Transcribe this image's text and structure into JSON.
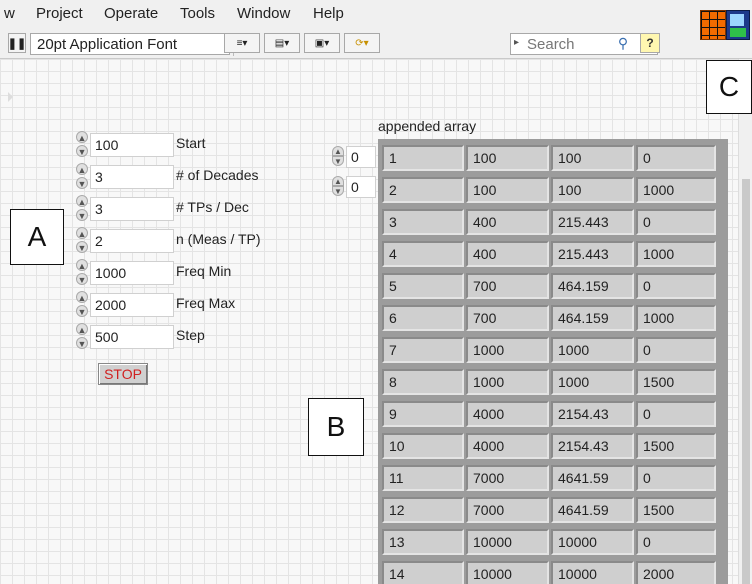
{
  "menu": {
    "items": [
      "w",
      "Project",
      "Operate",
      "Tools",
      "Window",
      "Help"
    ]
  },
  "toolbar": {
    "pause_icon": "pause-icon",
    "font": "20pt Application Font",
    "search_placeholder": "Search",
    "help_icon": "?"
  },
  "controls": [
    {
      "value": "100",
      "label": "Start"
    },
    {
      "value": "3",
      "label": "# of Decades"
    },
    {
      "value": "3",
      "label": "# TPs / Dec"
    },
    {
      "value": "2",
      "label": "n (Meas / TP)"
    },
    {
      "value": "1000",
      "label": "Freq Min"
    },
    {
      "value": "2000",
      "label": "Freq Max"
    },
    {
      "value": "500",
      "label": "Step"
    }
  ],
  "stop_label": "STOP",
  "array": {
    "label": "appended array",
    "index_row": "0",
    "index_col": "0",
    "rows": [
      [
        "1",
        "100",
        "100",
        "0"
      ],
      [
        "2",
        "100",
        "100",
        "1000"
      ],
      [
        "3",
        "400",
        "215.443",
        "0"
      ],
      [
        "4",
        "400",
        "215.443",
        "1000"
      ],
      [
        "5",
        "700",
        "464.159",
        "0"
      ],
      [
        "6",
        "700",
        "464.159",
        "1000"
      ],
      [
        "7",
        "1000",
        "1000",
        "0"
      ],
      [
        "8",
        "1000",
        "1000",
        "1500"
      ],
      [
        "9",
        "4000",
        "2154.43",
        "0"
      ],
      [
        "10",
        "4000",
        "2154.43",
        "1500"
      ],
      [
        "11",
        "7000",
        "4641.59",
        "0"
      ],
      [
        "12",
        "7000",
        "4641.59",
        "1500"
      ],
      [
        "13",
        "10000",
        "10000",
        "0"
      ],
      [
        "14",
        "10000",
        "10000",
        "2000"
      ]
    ]
  },
  "callouts": {
    "a": "A",
    "b": "B",
    "c": "C"
  },
  "colors": {
    "stop_text": "#d02020",
    "array_bg": "#9c9c9c",
    "cell_bg": "#cfcfcf"
  }
}
